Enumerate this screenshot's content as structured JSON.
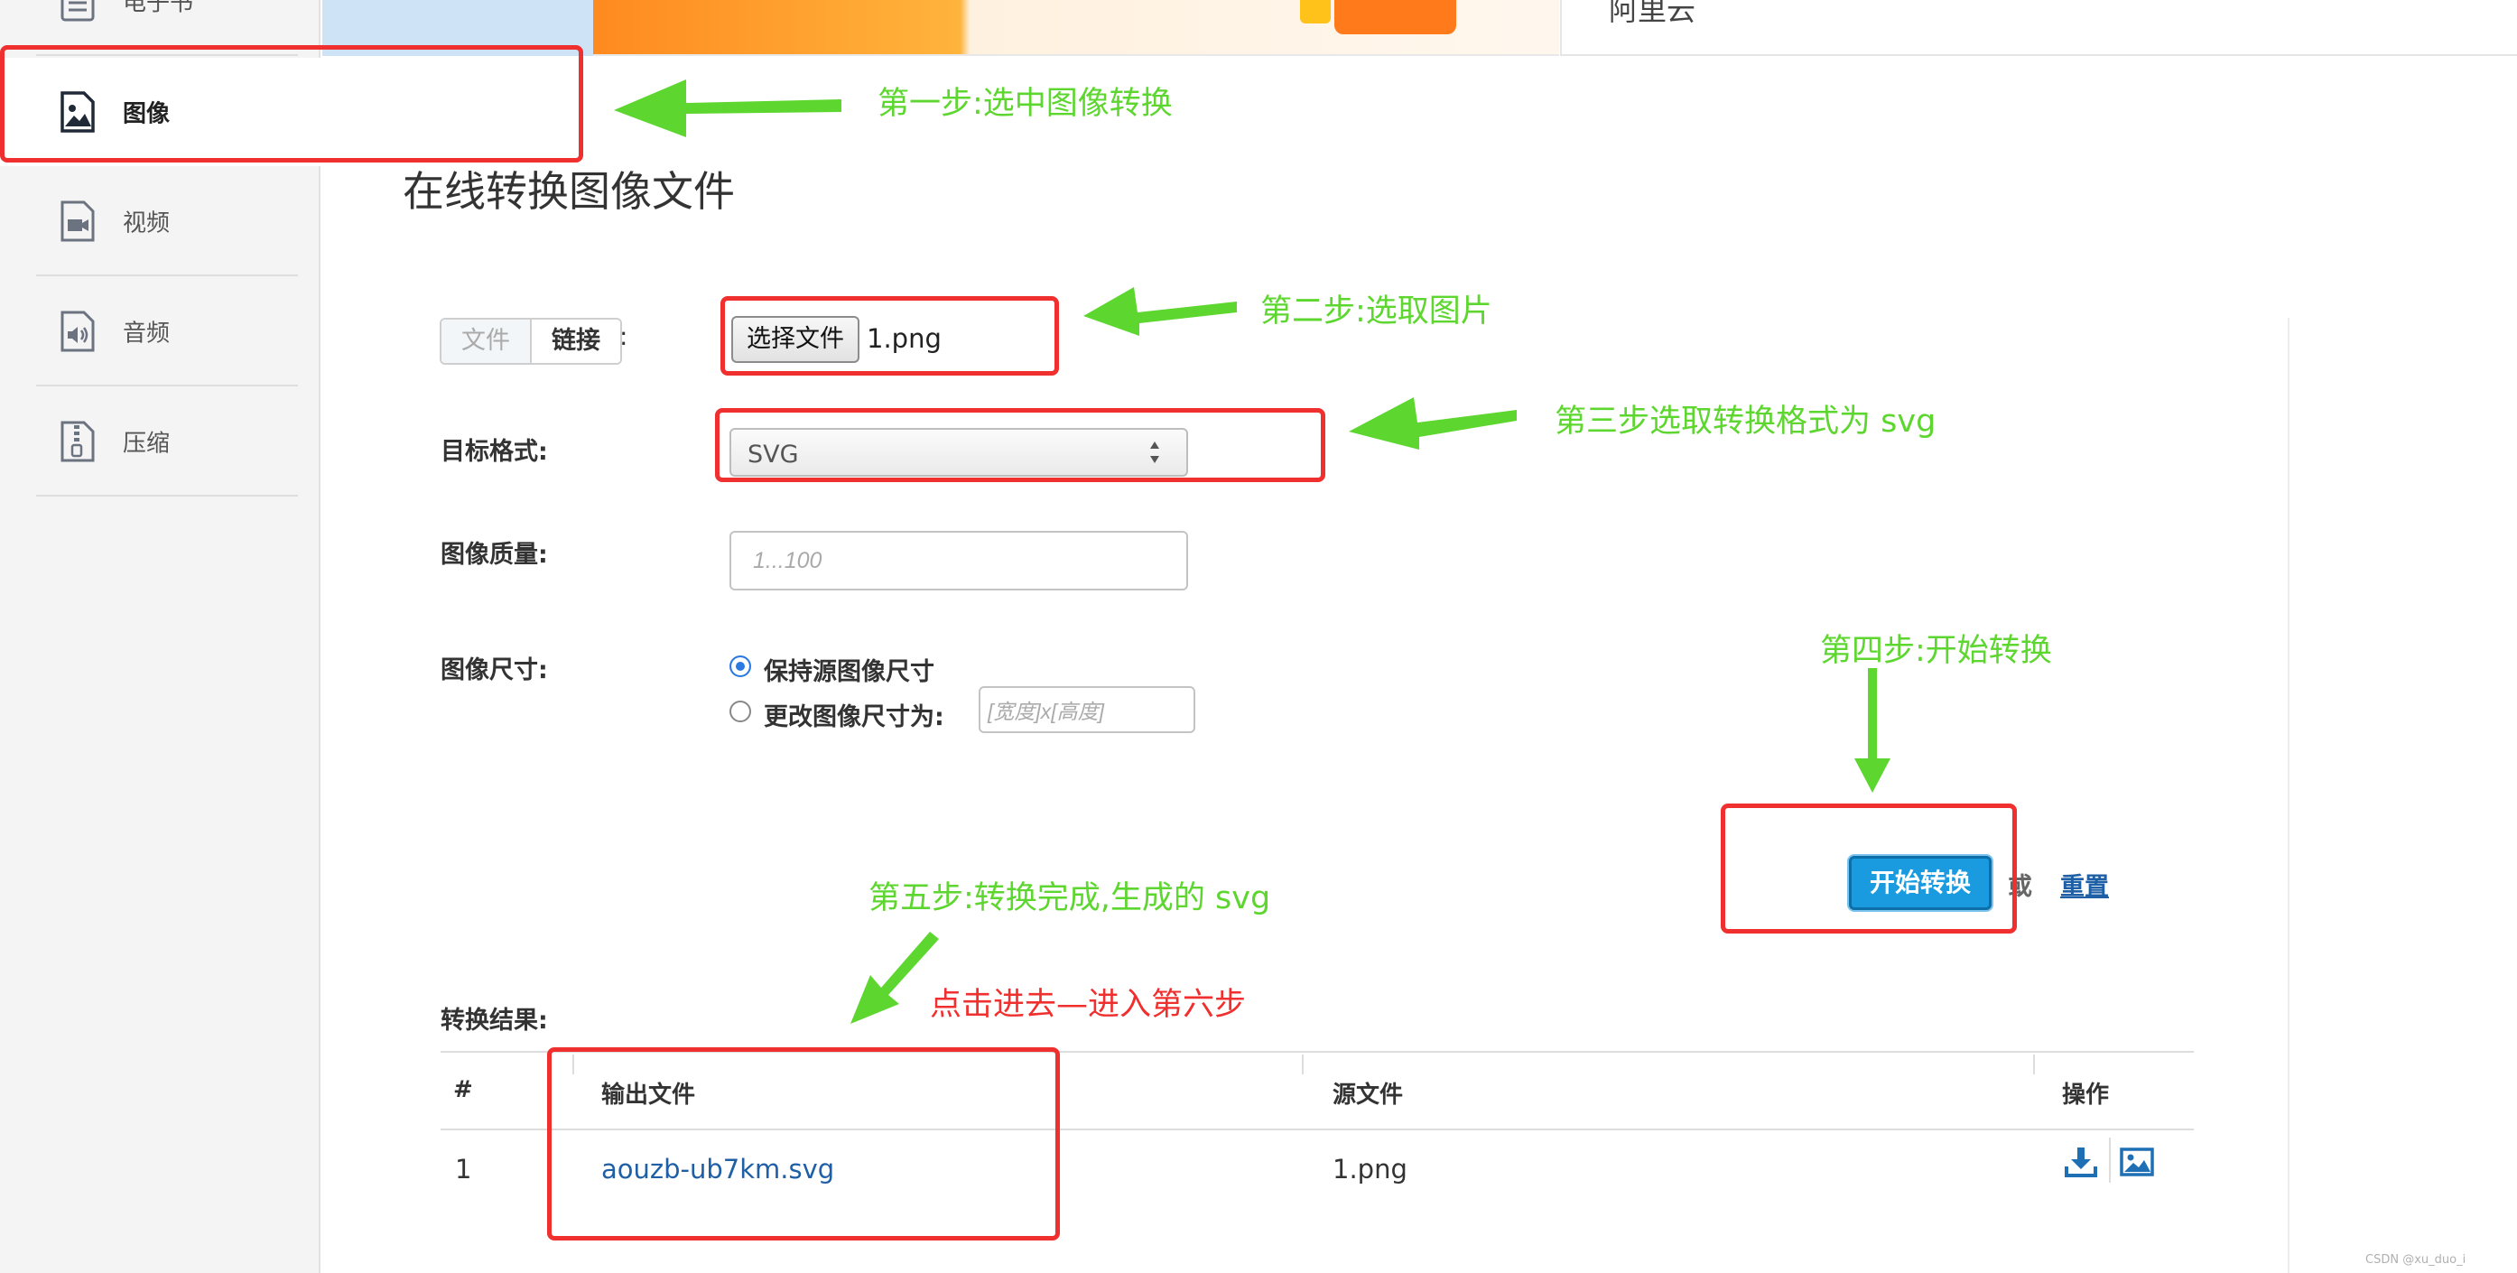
{
  "sidebar": {
    "items": [
      {
        "label": "电子书",
        "icon": "book-icon"
      },
      {
        "label": "图像",
        "icon": "image-file-icon",
        "active": true
      },
      {
        "label": "视频",
        "icon": "video-file-icon"
      },
      {
        "label": "音频",
        "icon": "audio-file-icon"
      },
      {
        "label": "压缩",
        "icon": "zip-file-icon"
      }
    ]
  },
  "banner": {
    "right_text": "阿里云"
  },
  "page": {
    "title": "在线转换图像文件"
  },
  "form": {
    "source_tabs": [
      "文件",
      "链接"
    ],
    "colon": ":",
    "file_button_label": "选择文件",
    "file_name": "1.png",
    "target_format_label": "目标格式:",
    "target_format_value": "SVG",
    "quality_label": "图像质量:",
    "quality_placeholder": "1...100",
    "size_label": "图像尺寸:",
    "size_options": [
      "保持源图像尺寸",
      "更改图像尺寸为:"
    ],
    "size_selected_index": 0,
    "size_placeholder": "[宽度]x[高度]",
    "start_button": "开始转换",
    "or_text": "或",
    "reset_link": "重置"
  },
  "result": {
    "label": "转换结果:",
    "columns": [
      "#",
      "输出文件",
      "源文件",
      "操作"
    ],
    "rows": [
      {
        "index": "1",
        "output_file": "aouzb-ub7km.svg",
        "source_file": "1.png"
      }
    ],
    "action_icons": [
      "download-icon",
      "image-preview-icon"
    ]
  },
  "annotations": {
    "step1": "第一步:选中图像转换",
    "step2": "第二步:选取图片",
    "step3": "第三步选取转换格式为  svg",
    "step4": "第四步:开始转换",
    "step5": "第五步:转换完成,生成的 svg",
    "step6": "点击进去—进入第六步",
    "arrow_color": "#5dd62f",
    "box_color": "#f0302e"
  },
  "watermark": "CSDN @xu_duo_i"
}
